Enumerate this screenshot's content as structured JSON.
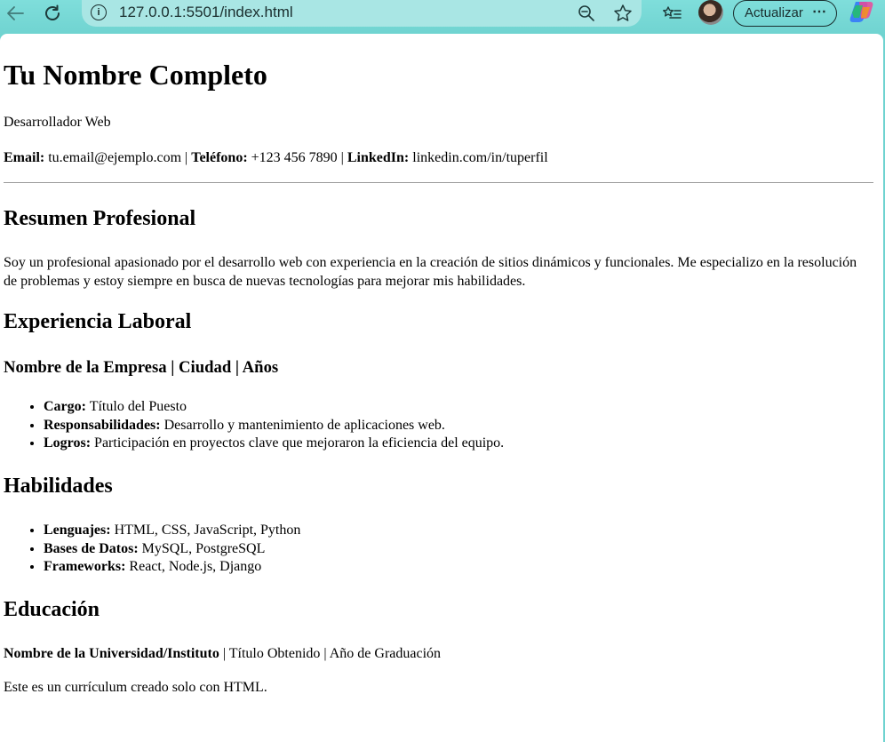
{
  "browser": {
    "url": "127.0.0.1:5501/index.html",
    "update_label": "Actualizar",
    "more_label": "⋯",
    "icons": [
      "back-arrow-icon",
      "reload-icon",
      "info-icon",
      "zoom-out-icon",
      "favorite-star-icon",
      "collections-icon",
      "profile-avatar",
      "copilot-icon",
      "more-icon"
    ]
  },
  "cv": {
    "name": "Tu Nombre Completo",
    "role": "Desarrollador Web",
    "contact": {
      "email_label": "Email:",
      "email": "tu.email@ejemplo.com",
      "sep1": "|",
      "phone_label": "Teléfono:",
      "phone": "+123 456 7890",
      "sep2": "|",
      "linkedin_label": "LinkedIn:",
      "linkedin": "linkedin.com/in/tuperfil"
    },
    "summary": {
      "heading": "Resumen Profesional",
      "text": "Soy un profesional apasionado por el desarrollo web con experiencia en la creación de sitios dinámicos y funcionales. Me especializo en la resolución de problemas y estoy siempre en busca de nuevas tecnologías para mejorar mis habilidades."
    },
    "experience": {
      "heading": "Experiencia Laboral",
      "company": "Nombre de la Empresa | Ciudad | Años",
      "items": [
        {
          "label": "Cargo:",
          "value": "Título del Puesto"
        },
        {
          "label": "Responsabilidades:",
          "value": "Desarrollo y mantenimiento de aplicaciones web."
        },
        {
          "label": "Logros:",
          "value": "Participación en proyectos clave que mejoraron la eficiencia del equipo."
        }
      ]
    },
    "skills": {
      "heading": "Habilidades",
      "items": [
        {
          "label": "Lenguajes:",
          "value": "HTML, CSS, JavaScript, Python"
        },
        {
          "label": "Bases de Datos:",
          "value": "MySQL, PostgreSQL"
        },
        {
          "label": "Frameworks:",
          "value": "React, Node.js, Django"
        }
      ]
    },
    "education": {
      "heading": "Educación",
      "institution": "Nombre de la Universidad/Instituto",
      "details": "| Título Obtenido | Año de Graduación"
    },
    "footer": "Este es un currículum creado solo con HTML."
  },
  "colors": {
    "browser_chrome": "#6fd3d0",
    "url_bar": "#a9e6e4",
    "page_background": "#ffffff"
  }
}
